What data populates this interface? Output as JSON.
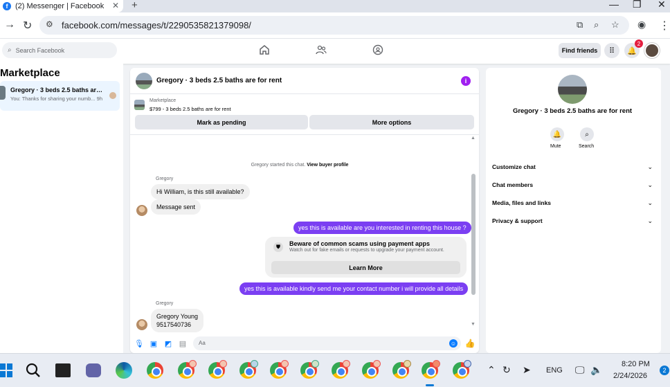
{
  "browser": {
    "tab_title": "(2) Messenger | Facebook",
    "tab_close": "✕",
    "new_tab": "+",
    "url": "facebook.com/messages/t/2290535821379098/",
    "win_min": "—",
    "win_max": "❐",
    "win_close": "✕"
  },
  "fb_header": {
    "search_placeholder": "Search Facebook",
    "find_friends": "Find friends",
    "notification_count": "2"
  },
  "left": {
    "title": "Marketplace",
    "conversation": {
      "name": "Gregory · 3 beds 2.5 baths are for rent",
      "preview": "You: Thanks for sharing your numb...  9h"
    }
  },
  "chat": {
    "title": "Gregory · 3 beds 2.5 baths are for rent",
    "marketplace_label": "Marketplace",
    "listing": "$799 - 3 beds 2.5 baths are for rent",
    "mark_pending": "Mark as pending",
    "more_options": "More options",
    "system_note": "Gregory started this chat.",
    "view_buyer": "View buyer profile",
    "messages": [
      {
        "sender": "Gregory",
        "text": "Hi William, is this still available?"
      },
      {
        "text": "Message sent"
      },
      {
        "text": "yes this is available are you interested in renting this house ?"
      },
      {
        "text": "yes this is available kindly send me your contact number i will provide all  details"
      },
      {
        "sender": "Gregory",
        "text_line1": "Gregory Young",
        "text_line2": "9517540736"
      }
    ],
    "scam_card": {
      "title": "Beware of common scams using payment apps",
      "subtitle": "Watch out for fake emails or requests to upgrade your payment account.",
      "button": "Learn More"
    },
    "composer_placeholder": "Aa"
  },
  "right": {
    "name": "Gregory · 3 beds 2.5 baths are for rent",
    "mute": "Mute",
    "search": "Search",
    "rows": [
      "Customize chat",
      "Chat members",
      "Media, files and links",
      "Privacy & support"
    ]
  },
  "taskbar": {
    "lang": "ENG",
    "time": "8:20 PM",
    "date": "2/24/2026",
    "notif_count": "2"
  },
  "colors": {
    "accent": "#7b3ff2",
    "fb_blue": "#1877f2"
  }
}
